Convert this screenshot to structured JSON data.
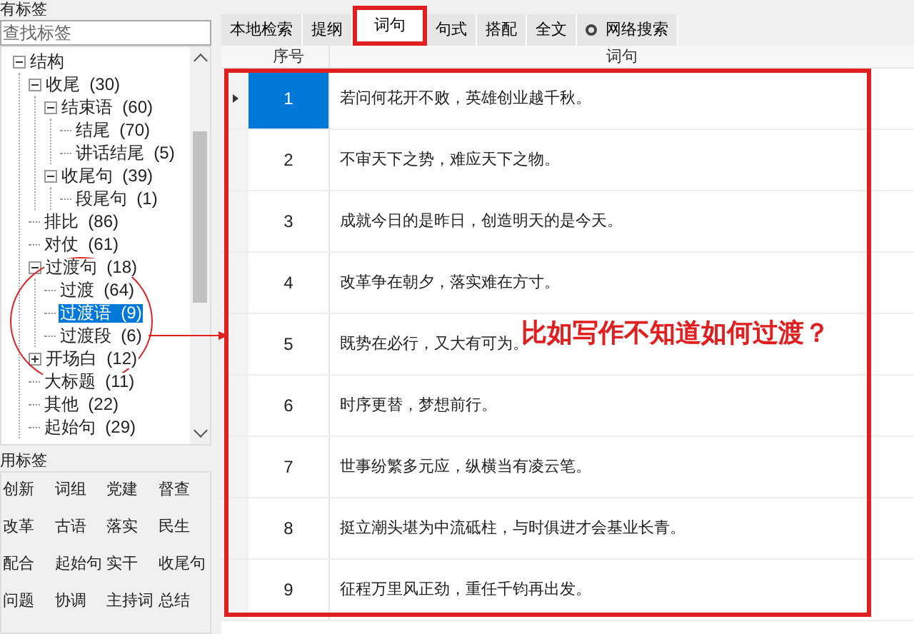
{
  "tag_panel": {
    "title": "有标签",
    "search": {
      "placeholder": "查找标签"
    },
    "tree": [
      {
        "label": "结构",
        "expanded": true,
        "selected": false,
        "children": [
          {
            "label": "收尾  (30)",
            "expanded": true,
            "selected": false,
            "children": [
              {
                "label": "结束语  (60)",
                "expanded": true,
                "selected": false,
                "children": [
                  {
                    "label": "结尾  (70)",
                    "selected": false
                  },
                  {
                    "label": "讲话结尾  (5)",
                    "selected": false
                  }
                ]
              },
              {
                "label": "收尾句  (39)",
                "expanded": true,
                "selected": false,
                "children": [
                  {
                    "label": "段尾句  (1)",
                    "selected": false
                  }
                ]
              }
            ]
          },
          {
            "label": "排比  (86)",
            "selected": false
          },
          {
            "label": "对仗  (61)",
            "selected": false
          },
          {
            "label": "过渡句  (18)",
            "expanded": true,
            "selected": false,
            "children": [
              {
                "label": "过渡  (64)",
                "selected": false
              },
              {
                "label": "过渡语  (9)",
                "selected": true
              },
              {
                "label": "过渡段  (6)",
                "selected": false
              }
            ]
          },
          {
            "label": "开场白  (12)",
            "expanded": false,
            "selected": false
          },
          {
            "label": "大标题  (11)",
            "selected": false
          },
          {
            "label": "其他  (22)",
            "selected": false
          },
          {
            "label": "起始句  (29)",
            "selected": false
          }
        ]
      }
    ]
  },
  "common_tags": {
    "title": "用标签",
    "tags": [
      "创新",
      "词组",
      "党建",
      "督查",
      "改革",
      "古语",
      "落实",
      "民生",
      "配合",
      "起始句",
      "实干",
      "收尾句",
      "问题",
      "协调",
      "主持词",
      "总结"
    ]
  },
  "tabs": [
    {
      "label": "本地检索",
      "selected": false,
      "highlighted": false
    },
    {
      "label": "提纲",
      "selected": false,
      "highlighted": false
    },
    {
      "label": "词句",
      "selected": true,
      "highlighted": true
    },
    {
      "label": "句式",
      "selected": false,
      "highlighted": false
    },
    {
      "label": "搭配",
      "selected": false,
      "highlighted": false
    },
    {
      "label": "全文",
      "selected": false,
      "highlighted": false
    },
    {
      "label": "网络搜索",
      "selected": false,
      "highlighted": false,
      "kind": "web"
    }
  ],
  "table": {
    "highlighted": true,
    "columns": [
      "序号",
      "词句"
    ],
    "rows": [
      {
        "number": "1",
        "text": "若问何花开不败，英雄创业越千秋。",
        "selected": true
      },
      {
        "number": "2",
        "text": "不审天下之势，难应天下之物。",
        "selected": false
      },
      {
        "number": "3",
        "text": "成就今日的是昨日，创造明天的是今天。",
        "selected": false
      },
      {
        "number": "4",
        "text": "改革争在朝夕，落实难在方寸。",
        "selected": false
      },
      {
        "number": "5",
        "text": "既势在必行，又大有可为。",
        "selected": false
      },
      {
        "number": "6",
        "text": "时序更替，梦想前行。",
        "selected": false
      },
      {
        "number": "7",
        "text": "世事纷繁多元应，纵横当有凌云笔。",
        "selected": false
      },
      {
        "number": "8",
        "text": "挺立潮头堪为中流砥柱，与时俱进才会基业长青。",
        "selected": false
      },
      {
        "number": "9",
        "text": "征程万里风正劲，重任千钧再出发。",
        "selected": false
      }
    ]
  },
  "annotation": {
    "text": "比如写作不知道如何过渡？",
    "circle": true
  }
}
